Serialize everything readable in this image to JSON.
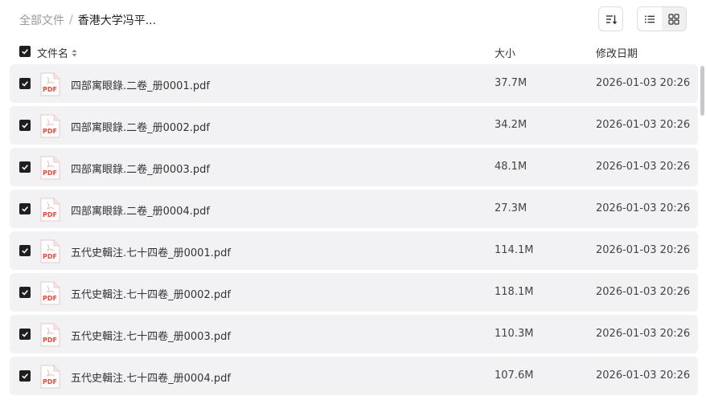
{
  "breadcrumb": {
    "root": "全部文件",
    "separator": "/",
    "current": "香港大学冯平..."
  },
  "toolbar": {
    "sort_icon": "sort-icon",
    "list_view_icon": "list-view-icon",
    "grid_view_icon": "grid-view-icon"
  },
  "header": {
    "name": "文件名",
    "size": "大小",
    "date": "修改日期"
  },
  "files": [
    {
      "name": "四部寓眼錄.二卷_册0001.pdf",
      "size": "37.7M",
      "date": "2026-01-03 20:26"
    },
    {
      "name": "四部寓眼錄.二卷_册0002.pdf",
      "size": "34.2M",
      "date": "2026-01-03 20:26"
    },
    {
      "name": "四部寓眼錄.二卷_册0003.pdf",
      "size": "48.1M",
      "date": "2026-01-03 20:26"
    },
    {
      "name": "四部寓眼錄.二卷_册0004.pdf",
      "size": "27.3M",
      "date": "2026-01-03 20:26"
    },
    {
      "name": "五代史輯注.七十四卷_册0001.pdf",
      "size": "114.1M",
      "date": "2026-01-03 20:26"
    },
    {
      "name": "五代史輯注.七十四卷_册0002.pdf",
      "size": "118.1M",
      "date": "2026-01-03 20:26"
    },
    {
      "name": "五代史輯注.七十四卷_册0003.pdf",
      "size": "110.3M",
      "date": "2026-01-03 20:26"
    },
    {
      "name": "五代史輯注.七十四卷_册0004.pdf",
      "size": "107.6M",
      "date": "2026-01-03 20:26"
    }
  ],
  "file_icon_label": "PDF",
  "colors": {
    "pdf_red": "#e8473e",
    "row_bg": "#f2f2f4",
    "checkbox": "#1f1f1f"
  }
}
